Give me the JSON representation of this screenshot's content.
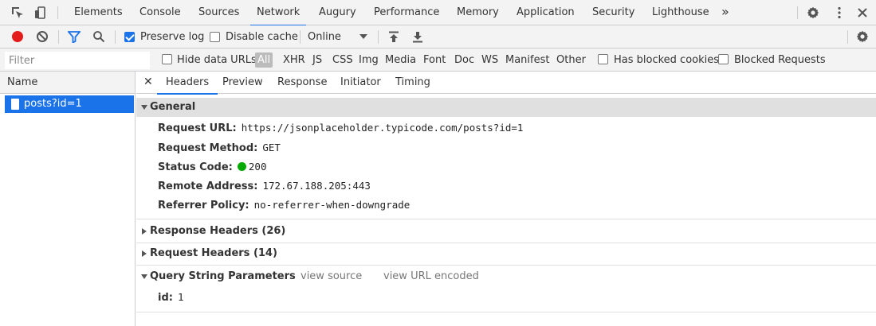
{
  "panel_tabs": [
    {
      "label": "Elements"
    },
    {
      "label": "Console"
    },
    {
      "label": "Sources"
    },
    {
      "label": "Network"
    },
    {
      "label": "Augury"
    },
    {
      "label": "Performance"
    },
    {
      "label": "Memory"
    },
    {
      "label": "Application"
    },
    {
      "label": "Security"
    },
    {
      "label": "Lighthouse"
    }
  ],
  "active_panel_tab": "Network",
  "toolbar": {
    "preserve_log_label": "Preserve log",
    "preserve_log_checked": true,
    "disable_cache_label": "Disable cache",
    "disable_cache_checked": false,
    "throttling_value": "Online"
  },
  "filter": {
    "placeholder": "Filter",
    "hide_data_urls_label": "Hide data URLs",
    "type_filters": [
      "All",
      "XHR",
      "JS",
      "CSS",
      "Img",
      "Media",
      "Font",
      "Doc",
      "WS",
      "Manifest",
      "Other"
    ],
    "selected_type": "All",
    "has_blocked_cookies_label": "Has blocked cookies",
    "blocked_requests_label": "Blocked Requests"
  },
  "request_list": {
    "header": "Name",
    "rows": [
      {
        "name": "posts?id=1",
        "selected": true
      }
    ]
  },
  "detail_tabs": [
    {
      "label": "Headers"
    },
    {
      "label": "Preview"
    },
    {
      "label": "Response"
    },
    {
      "label": "Initiator"
    },
    {
      "label": "Timing"
    }
  ],
  "active_detail_tab": "Headers",
  "general": {
    "title": "General",
    "rows": [
      {
        "key": "Request URL:",
        "value": "https://jsonplaceholder.typicode.com/posts?id=1"
      },
      {
        "key": "Request Method:",
        "value": "GET"
      },
      {
        "key": "Status Code:",
        "value": "200"
      },
      {
        "key": "Remote Address:",
        "value": "172.67.188.205:443"
      },
      {
        "key": "Referrer Policy:",
        "value": "no-referrer-when-downgrade"
      }
    ]
  },
  "response_headers": {
    "title": "Response Headers (26)"
  },
  "request_headers": {
    "title": "Request Headers (14)"
  },
  "query_params": {
    "title": "Query String Parameters",
    "view_source": "view source",
    "view_url_encoded": "view URL encoded",
    "rows": [
      {
        "key": "id:",
        "value": "1"
      }
    ]
  },
  "colors": {
    "accent": "#1a73e8",
    "record": "#e31b1b",
    "status_ok": "#00aa00"
  }
}
